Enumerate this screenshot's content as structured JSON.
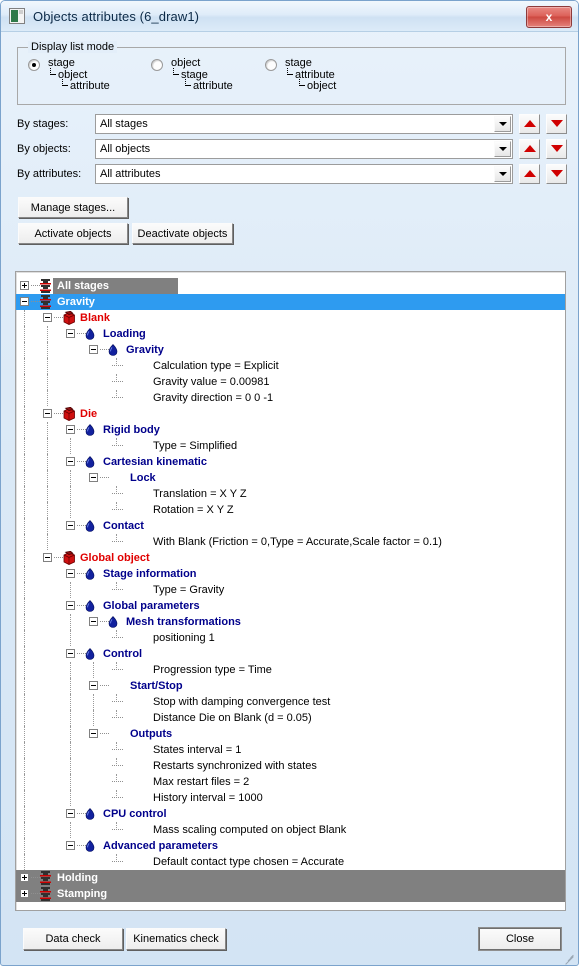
{
  "window": {
    "title": "Objects attributes (6_draw1)",
    "close_label": "x",
    "icon": "app-icon"
  },
  "display_list_mode": {
    "legend": "Display list mode",
    "options": [
      {
        "id": "stage-object-attribute",
        "l1": "stage",
        "l2": "object",
        "l3": "attribute",
        "checked": true
      },
      {
        "id": "object-stage-attribute",
        "l1": "object",
        "l2": "stage",
        "l3": "attribute",
        "checked": false
      },
      {
        "id": "stage-attribute-object",
        "l1": "stage",
        "l2": "attribute",
        "l3": "object",
        "checked": false
      }
    ]
  },
  "filters": [
    {
      "label": "By stages:",
      "value": "All stages"
    },
    {
      "label": "By objects:",
      "value": "All objects"
    },
    {
      "label": "By attributes:",
      "value": "All attributes"
    }
  ],
  "buttons": {
    "manage_stages": "Manage stages...",
    "activate_objects": "Activate objects",
    "deactivate_objects": "Deactivate objects",
    "data_check": "Data check",
    "kinematics_check": "Kinematics check",
    "close": "Close"
  },
  "colors": {
    "selection_blue": "#2e9bf0",
    "highlight_gray": "#808080",
    "object_red": "#e00000",
    "attribute_navy": "#00008b",
    "arrow_red": "#d00000"
  },
  "tree": [
    {
      "id": "all-stages",
      "depth": 0,
      "label": "All stages",
      "kind": "stage",
      "icon": "stage-press-icon",
      "expander": "plus",
      "highlight": "gray-partial"
    },
    {
      "id": "gravity-stage",
      "depth": 0,
      "label": "Gravity",
      "kind": "stage",
      "icon": "stage-press-icon",
      "expander": "minus",
      "highlight": "blue-full"
    },
    {
      "id": "blank",
      "depth": 1,
      "label": "Blank",
      "kind": "objred",
      "icon": "object-box-icon",
      "expander": "minus",
      "highlight": "none"
    },
    {
      "id": "loading",
      "depth": 2,
      "label": "Loading",
      "kind": "attr",
      "icon": "diamond-icon",
      "expander": "minus",
      "highlight": "none"
    },
    {
      "id": "gravity-attr",
      "depth": 3,
      "label": "Gravity",
      "kind": "attr",
      "icon": "diamond-icon",
      "expander": "minus",
      "highlight": "none"
    },
    {
      "id": "calculation-type",
      "depth": 4,
      "label": "Calculation type = Explicit",
      "kind": "leaf",
      "icon": "none",
      "expander": "none",
      "highlight": "none"
    },
    {
      "id": "gravity-value",
      "depth": 4,
      "label": "Gravity value = 0.00981",
      "kind": "leaf",
      "icon": "none",
      "expander": "none",
      "highlight": "none"
    },
    {
      "id": "gravity-direction",
      "depth": 4,
      "label": "Gravity direction = 0 0 -1",
      "kind": "leaf",
      "icon": "none",
      "expander": "none",
      "highlight": "none"
    },
    {
      "id": "die",
      "depth": 1,
      "label": "Die",
      "kind": "objred",
      "icon": "object-box-icon",
      "expander": "minus",
      "highlight": "none"
    },
    {
      "id": "rigid-body",
      "depth": 2,
      "label": "Rigid body",
      "kind": "attr",
      "icon": "diamond-icon",
      "expander": "minus",
      "highlight": "none"
    },
    {
      "id": "rigid-type",
      "depth": 4,
      "label": "Type = Simplified",
      "kind": "leaf",
      "icon": "none",
      "expander": "none",
      "highlight": "none"
    },
    {
      "id": "cartesian-kin",
      "depth": 2,
      "label": "Cartesian kinematic",
      "kind": "attr",
      "icon": "diamond-icon",
      "expander": "minus",
      "highlight": "none"
    },
    {
      "id": "lock",
      "depth": 3,
      "label": "Lock",
      "kind": "sub",
      "icon": "none",
      "expander": "minus",
      "highlight": "none"
    },
    {
      "id": "translation",
      "depth": 4,
      "label": "Translation = X Y Z",
      "kind": "leaf",
      "icon": "none",
      "expander": "none",
      "highlight": "none"
    },
    {
      "id": "rotation",
      "depth": 4,
      "label": "Rotation = X Y Z",
      "kind": "leaf",
      "icon": "none",
      "expander": "none",
      "highlight": "none"
    },
    {
      "id": "contact",
      "depth": 2,
      "label": "Contact",
      "kind": "attr",
      "icon": "diamond-icon",
      "expander": "minus",
      "highlight": "none"
    },
    {
      "id": "contact-with-blank",
      "depth": 4,
      "label": "With Blank (Friction = 0,Type = Accurate,Scale factor = 0.1)",
      "kind": "leaf",
      "icon": "none",
      "expander": "none",
      "highlight": "none"
    },
    {
      "id": "global-object",
      "depth": 1,
      "label": "Global object",
      "kind": "objred",
      "icon": "object-box-icon",
      "expander": "minus",
      "highlight": "none"
    },
    {
      "id": "stage-information",
      "depth": 2,
      "label": "Stage information",
      "kind": "attr",
      "icon": "diamond-icon",
      "expander": "minus",
      "highlight": "none"
    },
    {
      "id": "stage-type",
      "depth": 4,
      "label": "Type = Gravity",
      "kind": "leaf",
      "icon": "none",
      "expander": "none",
      "highlight": "none"
    },
    {
      "id": "global-parameters",
      "depth": 2,
      "label": "Global parameters",
      "kind": "attr",
      "icon": "diamond-icon",
      "expander": "minus",
      "highlight": "none"
    },
    {
      "id": "mesh-transforms",
      "depth": 3,
      "label": "Mesh transformations",
      "kind": "attr",
      "icon": "diamond-icon",
      "expander": "minus",
      "highlight": "none"
    },
    {
      "id": "positioning-1",
      "depth": 4,
      "label": "positioning 1",
      "kind": "leaf",
      "icon": "none",
      "expander": "none",
      "highlight": "none"
    },
    {
      "id": "control",
      "depth": 2,
      "label": "Control",
      "kind": "attr",
      "icon": "diamond-icon",
      "expander": "minus",
      "highlight": "none"
    },
    {
      "id": "progression-type",
      "depth": 4,
      "label": "Progression type = Time",
      "kind": "leaf",
      "icon": "none",
      "expander": "none",
      "highlight": "none"
    },
    {
      "id": "start-stop",
      "depth": 3,
      "label": "Start/Stop",
      "kind": "sub",
      "icon": "none",
      "expander": "minus",
      "highlight": "none"
    },
    {
      "id": "stop-damping",
      "depth": 4,
      "label": "Stop with damping convergence test",
      "kind": "leaf",
      "icon": "none",
      "expander": "none",
      "highlight": "none"
    },
    {
      "id": "distance-die-blank",
      "depth": 4,
      "label": "Distance Die on Blank (d = 0.05)",
      "kind": "leaf",
      "icon": "none",
      "expander": "none",
      "highlight": "none"
    },
    {
      "id": "outputs",
      "depth": 3,
      "label": "Outputs",
      "kind": "sub",
      "icon": "none",
      "expander": "minus",
      "highlight": "none"
    },
    {
      "id": "states-interval",
      "depth": 4,
      "label": "States interval = 1",
      "kind": "leaf",
      "icon": "none",
      "expander": "none",
      "highlight": "none"
    },
    {
      "id": "restarts-sync",
      "depth": 4,
      "label": "Restarts synchronized with states",
      "kind": "leaf",
      "icon": "none",
      "expander": "none",
      "highlight": "none"
    },
    {
      "id": "max-restart-files",
      "depth": 4,
      "label": "Max restart files = 2",
      "kind": "leaf",
      "icon": "none",
      "expander": "none",
      "highlight": "none"
    },
    {
      "id": "history-interval",
      "depth": 4,
      "label": "History interval = 1000",
      "kind": "leaf",
      "icon": "none",
      "expander": "none",
      "highlight": "none"
    },
    {
      "id": "cpu-control",
      "depth": 2,
      "label": "CPU control",
      "kind": "attr",
      "icon": "diamond-icon",
      "expander": "minus",
      "highlight": "none"
    },
    {
      "id": "mass-scaling",
      "depth": 4,
      "label": "Mass scaling computed on object Blank",
      "kind": "leaf",
      "icon": "none",
      "expander": "none",
      "highlight": "none"
    },
    {
      "id": "advanced-params",
      "depth": 2,
      "label": "Advanced parameters",
      "kind": "attr",
      "icon": "diamond-icon",
      "expander": "minus",
      "highlight": "none"
    },
    {
      "id": "default-contact",
      "depth": 4,
      "label": "Default contact type chosen = Accurate",
      "kind": "leaf",
      "icon": "none",
      "expander": "none",
      "highlight": "none"
    },
    {
      "id": "holding",
      "depth": 0,
      "label": "Holding",
      "kind": "stage",
      "icon": "stage-press-icon",
      "expander": "plus",
      "highlight": "gray-full"
    },
    {
      "id": "stamping",
      "depth": 0,
      "label": "Stamping",
      "kind": "stage",
      "icon": "stage-press-icon",
      "expander": "plus",
      "highlight": "gray-full"
    }
  ]
}
